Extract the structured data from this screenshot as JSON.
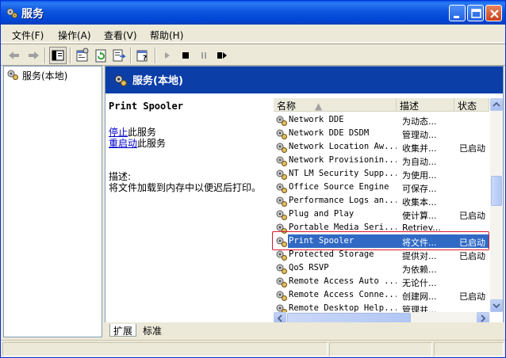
{
  "window": {
    "title": "服务"
  },
  "menu": [
    {
      "label": "文件(F)"
    },
    {
      "label": "操作(A)"
    },
    {
      "label": "查看(V)"
    },
    {
      "label": "帮助(H)"
    }
  ],
  "toolbar_icons": [
    "back-arrow-icon",
    "forward-arrow-icon",
    "show-hide-tree-icon",
    "properties-icon",
    "refresh-icon",
    "export-list-icon",
    "help-icon",
    "start-service-icon",
    "stop-service-icon",
    "pause-service-icon",
    "restart-service-icon"
  ],
  "tree": {
    "root_label": "服务(本地)"
  },
  "panel": {
    "title": "服务(本地)"
  },
  "detail": {
    "service_name": "Print Spooler",
    "stop_link": "停止",
    "stop_suffix": "此服务",
    "restart_link": "重启动",
    "restart_suffix": "此服务",
    "desc_label": "描述:",
    "desc_text": "将文件加载到内存中以便迟后打印。"
  },
  "list": {
    "columns": {
      "name": "名称",
      "description": "描述",
      "status": "状态"
    },
    "rows": [
      {
        "name": "Network DDE",
        "description": "为动态...",
        "status": ""
      },
      {
        "name": "Network DDE DSDM",
        "description": "管理动...",
        "status": ""
      },
      {
        "name": "Network Location Aw...",
        "description": "收集并...",
        "status": "已启动"
      },
      {
        "name": "Network Provisionin...",
        "description": "为自动...",
        "status": ""
      },
      {
        "name": "NT LM Security Supp...",
        "description": "为使用...",
        "status": ""
      },
      {
        "name": "Office Source Engine",
        "description": "可保存...",
        "status": ""
      },
      {
        "name": "Performance Logs an...",
        "description": "收集本...",
        "status": ""
      },
      {
        "name": "Plug and Play",
        "description": "使计算...",
        "status": "已启动"
      },
      {
        "name": "Portable Media Seri...",
        "description": "Retriev...",
        "status": ""
      },
      {
        "name": "Print Spooler",
        "description": "将文件...",
        "status": "已启动"
      },
      {
        "name": "Protected Storage",
        "description": "提供对...",
        "status": "已启动"
      },
      {
        "name": "QoS RSVP",
        "description": "为依赖...",
        "status": ""
      },
      {
        "name": "Remote Access Auto ...",
        "description": "无论什...",
        "status": ""
      },
      {
        "name": "Remote Access Conne...",
        "description": "创建网...",
        "status": "已启动"
      },
      {
        "name": "Remote Desktop Help...",
        "description": "管理并...",
        "status": ""
      }
    ],
    "selected_index": 9
  },
  "tabs": [
    {
      "label": "扩展"
    },
    {
      "label": "标准"
    }
  ],
  "colors": {
    "titlebar": "#0046d5",
    "selection": "#316ac5",
    "highlight_box": "#d8192a",
    "link": "#0000cc"
  }
}
